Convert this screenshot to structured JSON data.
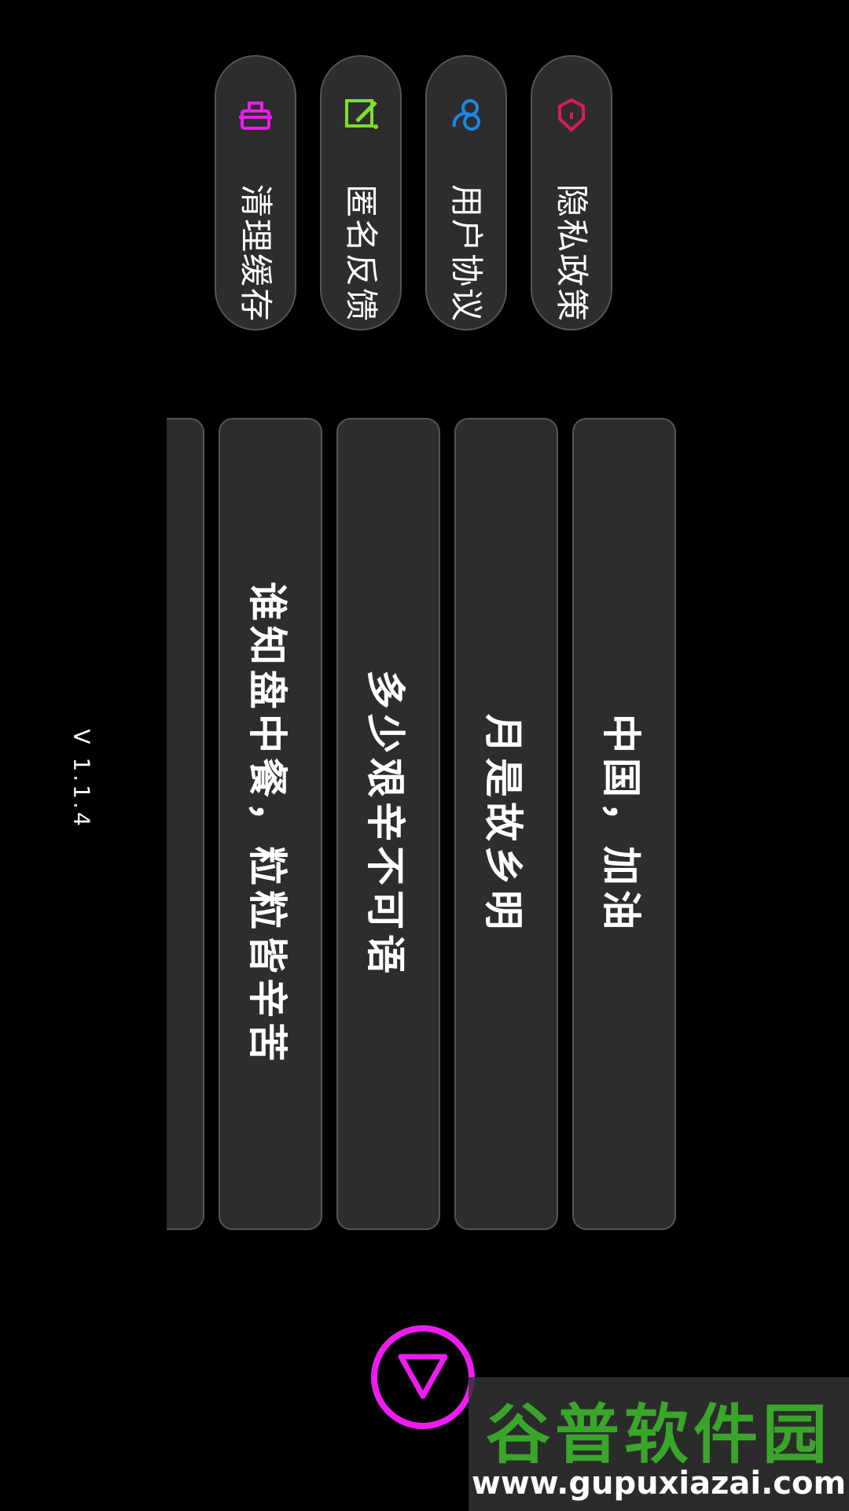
{
  "menu": [
    {
      "label": "清理缓存",
      "icon": "cleanup-icon",
      "color": "#ee1cf0"
    },
    {
      "label": "匿名反馈",
      "icon": "feedback-edit-icon",
      "color": "#7ce02e"
    },
    {
      "label": "用户协议",
      "icon": "user-agreement-icon",
      "color": "#1e88e5"
    },
    {
      "label": "隐私政策",
      "icon": "privacy-shield-icon",
      "color": "#d81b60"
    }
  ],
  "cards": [
    "谁知盘中餐，粒粒皆辛苦",
    "多少艰辛不可语",
    "月是故乡明",
    "中国，加油"
  ],
  "version": "V 1.1.4",
  "play_button": {
    "icon": "triangle-down-icon",
    "color": "#ee1cf0"
  },
  "watermark": {
    "logo": "谷普软件园",
    "url": "www.gupuxiazai.com"
  }
}
